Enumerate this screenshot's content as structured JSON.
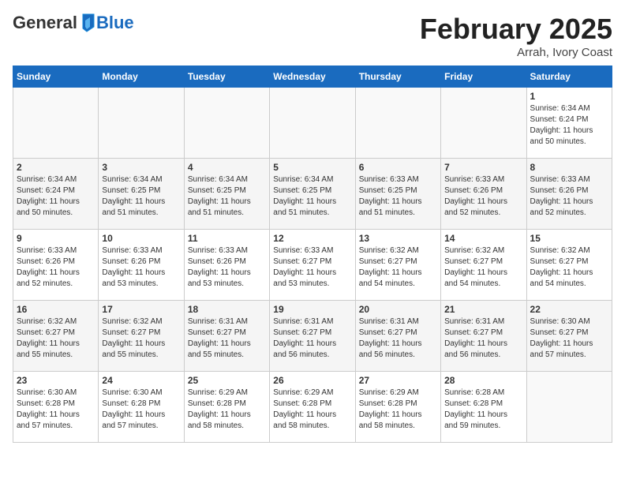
{
  "header": {
    "logo_general": "General",
    "logo_blue": "Blue",
    "month_title": "February 2025",
    "location": "Arrah, Ivory Coast"
  },
  "days_of_week": [
    "Sunday",
    "Monday",
    "Tuesday",
    "Wednesday",
    "Thursday",
    "Friday",
    "Saturday"
  ],
  "weeks": [
    [
      {
        "day": "",
        "info": ""
      },
      {
        "day": "",
        "info": ""
      },
      {
        "day": "",
        "info": ""
      },
      {
        "day": "",
        "info": ""
      },
      {
        "day": "",
        "info": ""
      },
      {
        "day": "",
        "info": ""
      },
      {
        "day": "1",
        "info": "Sunrise: 6:34 AM\nSunset: 6:24 PM\nDaylight: 11 hours\nand 50 minutes."
      }
    ],
    [
      {
        "day": "2",
        "info": "Sunrise: 6:34 AM\nSunset: 6:24 PM\nDaylight: 11 hours\nand 50 minutes."
      },
      {
        "day": "3",
        "info": "Sunrise: 6:34 AM\nSunset: 6:25 PM\nDaylight: 11 hours\nand 51 minutes."
      },
      {
        "day": "4",
        "info": "Sunrise: 6:34 AM\nSunset: 6:25 PM\nDaylight: 11 hours\nand 51 minutes."
      },
      {
        "day": "5",
        "info": "Sunrise: 6:34 AM\nSunset: 6:25 PM\nDaylight: 11 hours\nand 51 minutes."
      },
      {
        "day": "6",
        "info": "Sunrise: 6:33 AM\nSunset: 6:25 PM\nDaylight: 11 hours\nand 51 minutes."
      },
      {
        "day": "7",
        "info": "Sunrise: 6:33 AM\nSunset: 6:26 PM\nDaylight: 11 hours\nand 52 minutes."
      },
      {
        "day": "8",
        "info": "Sunrise: 6:33 AM\nSunset: 6:26 PM\nDaylight: 11 hours\nand 52 minutes."
      }
    ],
    [
      {
        "day": "9",
        "info": "Sunrise: 6:33 AM\nSunset: 6:26 PM\nDaylight: 11 hours\nand 52 minutes."
      },
      {
        "day": "10",
        "info": "Sunrise: 6:33 AM\nSunset: 6:26 PM\nDaylight: 11 hours\nand 53 minutes."
      },
      {
        "day": "11",
        "info": "Sunrise: 6:33 AM\nSunset: 6:26 PM\nDaylight: 11 hours\nand 53 minutes."
      },
      {
        "day": "12",
        "info": "Sunrise: 6:33 AM\nSunset: 6:27 PM\nDaylight: 11 hours\nand 53 minutes."
      },
      {
        "day": "13",
        "info": "Sunrise: 6:32 AM\nSunset: 6:27 PM\nDaylight: 11 hours\nand 54 minutes."
      },
      {
        "day": "14",
        "info": "Sunrise: 6:32 AM\nSunset: 6:27 PM\nDaylight: 11 hours\nand 54 minutes."
      },
      {
        "day": "15",
        "info": "Sunrise: 6:32 AM\nSunset: 6:27 PM\nDaylight: 11 hours\nand 54 minutes."
      }
    ],
    [
      {
        "day": "16",
        "info": "Sunrise: 6:32 AM\nSunset: 6:27 PM\nDaylight: 11 hours\nand 55 minutes."
      },
      {
        "day": "17",
        "info": "Sunrise: 6:32 AM\nSunset: 6:27 PM\nDaylight: 11 hours\nand 55 minutes."
      },
      {
        "day": "18",
        "info": "Sunrise: 6:31 AM\nSunset: 6:27 PM\nDaylight: 11 hours\nand 55 minutes."
      },
      {
        "day": "19",
        "info": "Sunrise: 6:31 AM\nSunset: 6:27 PM\nDaylight: 11 hours\nand 56 minutes."
      },
      {
        "day": "20",
        "info": "Sunrise: 6:31 AM\nSunset: 6:27 PM\nDaylight: 11 hours\nand 56 minutes."
      },
      {
        "day": "21",
        "info": "Sunrise: 6:31 AM\nSunset: 6:27 PM\nDaylight: 11 hours\nand 56 minutes."
      },
      {
        "day": "22",
        "info": "Sunrise: 6:30 AM\nSunset: 6:27 PM\nDaylight: 11 hours\nand 57 minutes."
      }
    ],
    [
      {
        "day": "23",
        "info": "Sunrise: 6:30 AM\nSunset: 6:28 PM\nDaylight: 11 hours\nand 57 minutes."
      },
      {
        "day": "24",
        "info": "Sunrise: 6:30 AM\nSunset: 6:28 PM\nDaylight: 11 hours\nand 57 minutes."
      },
      {
        "day": "25",
        "info": "Sunrise: 6:29 AM\nSunset: 6:28 PM\nDaylight: 11 hours\nand 58 minutes."
      },
      {
        "day": "26",
        "info": "Sunrise: 6:29 AM\nSunset: 6:28 PM\nDaylight: 11 hours\nand 58 minutes."
      },
      {
        "day": "27",
        "info": "Sunrise: 6:29 AM\nSunset: 6:28 PM\nDaylight: 11 hours\nand 58 minutes."
      },
      {
        "day": "28",
        "info": "Sunrise: 6:28 AM\nSunset: 6:28 PM\nDaylight: 11 hours\nand 59 minutes."
      },
      {
        "day": "",
        "info": ""
      }
    ]
  ]
}
